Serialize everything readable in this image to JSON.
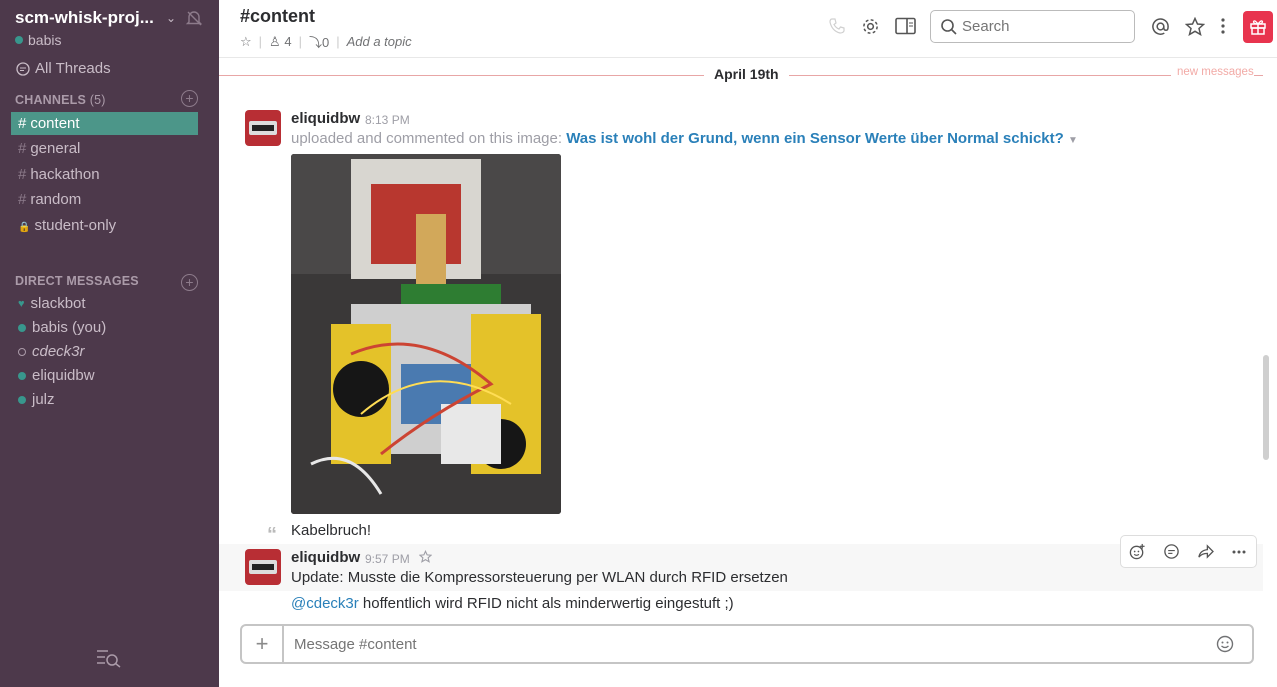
{
  "team": {
    "name": "scm-whisk-proj...",
    "user": "babis"
  },
  "nav": {
    "all_threads": "All Threads"
  },
  "channels_section": {
    "title": "CHANNELS",
    "count": "(5)"
  },
  "channels": [
    {
      "name": "content",
      "active": true
    },
    {
      "name": "general"
    },
    {
      "name": "hackathon"
    },
    {
      "name": "random"
    },
    {
      "name": "student-only",
      "locked": true
    }
  ],
  "dm_section": {
    "title": "DIRECT MESSAGES"
  },
  "dms": [
    {
      "name": "slackbot"
    },
    {
      "name": "babis (you)"
    },
    {
      "name": "cdeck3r"
    },
    {
      "name": "eliquidbw"
    },
    {
      "name": "julz"
    }
  ],
  "header": {
    "title": "#content",
    "members": "4",
    "pins": "0",
    "topic": "Add a topic"
  },
  "search": {
    "placeholder": "Search"
  },
  "day_divider": {
    "label": "April 19th",
    "new_messages": "new messages"
  },
  "messages": [
    {
      "sender": "eliquidbw",
      "time": "8:13 PM",
      "upload_meta": "uploaded and commented on this image: ",
      "file_title": "Was ist wohl der Grund, wenn ein Sensor Werte über Normal schickt?",
      "comment": "Kabelbruch!"
    },
    {
      "sender": "eliquidbw",
      "time": "9:57 PM",
      "text": "Update: Musste die Kompressorsteuerung per WLAN durch RFID ersetzen",
      "mention": "@cdeck3r",
      "followup": " hoffentlich wird RFID nicht als minderwertig eingestuft ;)"
    }
  ],
  "composer": {
    "placeholder": "Message #content"
  },
  "colors": {
    "sidebar": "#4d394b",
    "active_channel": "#4c9689",
    "link": "#2a80b9",
    "gift": "#e8344e"
  }
}
